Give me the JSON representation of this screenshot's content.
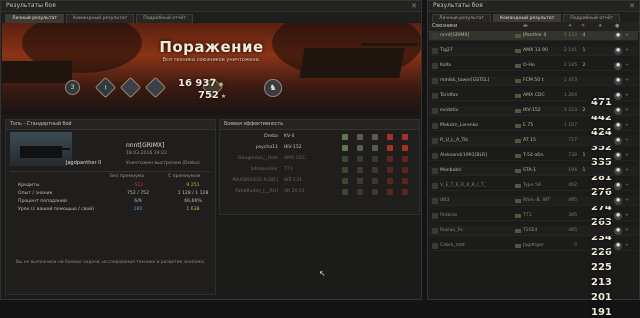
{
  "left_window": {
    "title": "Результаты боя",
    "close_label": "✕",
    "tabs": [
      {
        "label": "Личный результат"
      },
      {
        "label": "Командный результат"
      },
      {
        "label": "Подробный отчёт"
      }
    ]
  },
  "right_window": {
    "title": "Результаты боя",
    "close_label": "✕",
    "tabs": [
      {
        "label": "Личный результат"
      },
      {
        "label": "Командный результат"
      },
      {
        "label": "Подробный отчёт"
      }
    ],
    "team_title": "Союзники"
  },
  "result": {
    "title": "Поражение",
    "subtitle": "Вся техника союзников уничтожена.",
    "credits": "16 937",
    "xp": "752",
    "medals": [
      {
        "label": "3",
        "icon": "class-badge-icon"
      },
      {
        "label": "I",
        "icon": "mastery-badge-icon"
      },
      {
        "label": "",
        "icon": "medal-icon"
      },
      {
        "label": "",
        "icon": "medal-icon"
      },
      {
        "label": "",
        "icon": "medal-icon"
      }
    ],
    "credits_icon": "credits-icon",
    "xp_icon": "star-icon"
  },
  "card": {
    "header": "Топь - Стандартный бой",
    "tank": "Jagdpanther II",
    "player": "nnnt[GRIMX]",
    "date": "18.03.2016 19:22",
    "status": "Уничтожен выстрелом (Dreba)",
    "col_no_premium": "Без премиума",
    "col_premium": "С премиумом",
    "rows": [
      {
        "label": "Кредиты",
        "v1": "-512",
        "v2": "9 251"
      },
      {
        "label": "Опыт / знаник",
        "v1": "752 / 752",
        "v2": "1 128 / 1 128"
      },
      {
        "label": "Процент попаданий",
        "v1": "6/9",
        "v2": "66,66%"
      },
      {
        "label": "Урон (с вашей помощью / свой)",
        "v1": "280",
        "v2": "1 638"
      }
    ],
    "message": "Вы не выполнили ни боевые задачи, исследования техники и развитие экипажа."
  },
  "efficiency": {
    "header": "Боевая эффективность",
    "rows": [
      {
        "name": "Dreba",
        "tank": "KV-4",
        "dim": false
      },
      {
        "name": "psycho11",
        "tank": "IKV-152",
        "dim": false
      },
      {
        "name": "Dangerous__Hole",
        "tank": "AMX CDC",
        "dim": true
      },
      {
        "name": "bitetovskier",
        "tank": "T71",
        "dim": true
      },
      {
        "name": "MAXDRIVE[G-R-DIE]",
        "tank": "WZ-131",
        "dim": true
      },
      {
        "name": "FatalBuddy_[__RU]",
        "tank": "VK 20.01",
        "dim": true
      }
    ]
  },
  "allies": [
    {
      "name": "nnnt[GRIMX]",
      "tank": "JPanther II",
      "dmg": "1 133",
      "kills": "4",
      "xp": "471",
      "me": true
    },
    {
      "name": "Tig27",
      "tank": "AMX 13 90",
      "dmg": "2 141",
      "kills": "1",
      "xp": "442"
    },
    {
      "name": "Kolla",
      "tank": "O-Ho",
      "dmg": "2 185",
      "kills": "2",
      "xp": "424"
    },
    {
      "name": "mmikk_tower[GSTEL]",
      "tank": "FCM 50 t",
      "dmg": "1 473",
      "kills": "",
      "xp": "352"
    },
    {
      "name": "Toridfox",
      "tank": "AMX CDC",
      "dmg": "1 264",
      "kills": "",
      "xp": "335"
    },
    {
      "name": "evidotiv",
      "tank": "IKV-152",
      "dmg": "1 223",
      "kills": "2",
      "xp": "281"
    },
    {
      "name": "Maksim_Lorenko",
      "tank": "E 75",
      "dmg": "1 167",
      "kills": "",
      "xp": "276"
    },
    {
      "name": "R_U_L_A_Tik",
      "tank": "AT 15",
      "dmg": "717",
      "kills": "",
      "xp": "274"
    },
    {
      "name": "Aleksandr1991[BLR]",
      "tank": "T-54 обл.",
      "dmg": "738",
      "kills": "1",
      "xp": "263"
    },
    {
      "name": "Monbobri",
      "tank": "STA-1",
      "dmg": "194",
      "kills": "1",
      "xp": "234"
    },
    {
      "name": "V_E_T_E_R_K_R_I_T_",
      "tank": "Type 59",
      "dmg": "492",
      "kills": "",
      "xp": "226"
    },
    {
      "name": "dtt3",
      "tank": "Rhm.-B. WT",
      "dmg": "495",
      "kills": "",
      "xp": "225"
    },
    {
      "name": "fmibros",
      "tank": "T71",
      "dmg": "385",
      "kills": "",
      "xp": "213"
    },
    {
      "name": "Ruslan_Fe",
      "tank": "T26E4",
      "dmg": "485",
      "kills": "",
      "xp": "201"
    },
    {
      "name": "Cebrk_mbt",
      "tank": "Jagdtiger",
      "dmg": "0",
      "kills": "",
      "xp": "191"
    }
  ]
}
